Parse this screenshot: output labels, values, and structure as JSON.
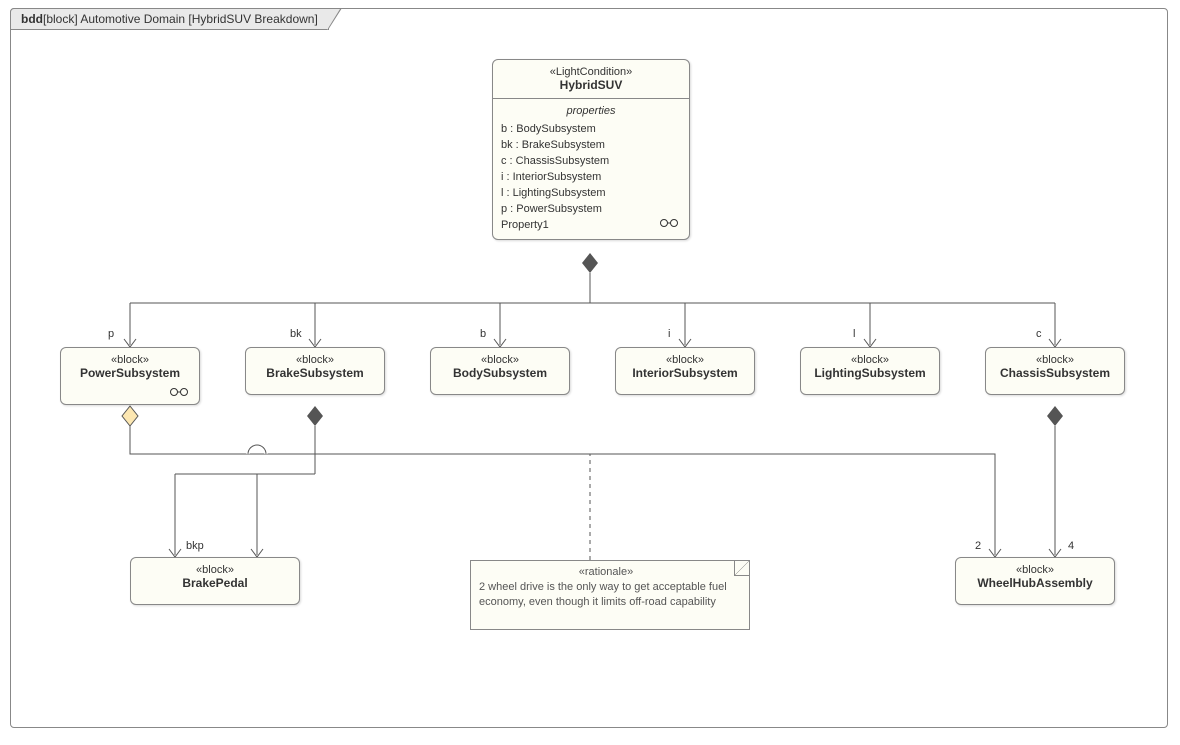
{
  "frame": {
    "prefix": "bdd",
    "bracket": "[block] Automotive Domain [HybridSUV Breakdown]"
  },
  "blocks": {
    "hybrid": {
      "stereo": "«LightCondition»",
      "name": "HybridSUV",
      "compart_title": "properties",
      "props": [
        "b : BodySubsystem",
        "bk : BrakeSubsystem",
        "c : ChassisSubsystem",
        "i : InteriorSubsystem",
        "l : LightingSubsystem",
        "p : PowerSubsystem",
        "Property1"
      ]
    },
    "power": {
      "stereo": "«block»",
      "name": "PowerSubsystem"
    },
    "brake": {
      "stereo": "«block»",
      "name": "BrakeSubsystem"
    },
    "body": {
      "stereo": "«block»",
      "name": "BodySubsystem"
    },
    "interior": {
      "stereo": "«block»",
      "name": "InteriorSubsystem"
    },
    "lighting": {
      "stereo": "«block»",
      "name": "LightingSubsystem"
    },
    "chassis": {
      "stereo": "«block»",
      "name": "ChassisSubsystem"
    },
    "pedal": {
      "stereo": "«block»",
      "name": "BrakePedal"
    },
    "wha": {
      "stereo": "«block»",
      "name": "WheelHubAssembly"
    }
  },
  "roles": {
    "p": "p",
    "bk": "bk",
    "b": "b",
    "i": "i",
    "l": "l",
    "c": "c",
    "bkp": "bkp",
    "m2": "2",
    "m4": "4"
  },
  "note": {
    "stereo": "«rationale»",
    "text": "2 wheel drive is the only way to get acceptable fuel economy, even though it limits off-road capability"
  }
}
